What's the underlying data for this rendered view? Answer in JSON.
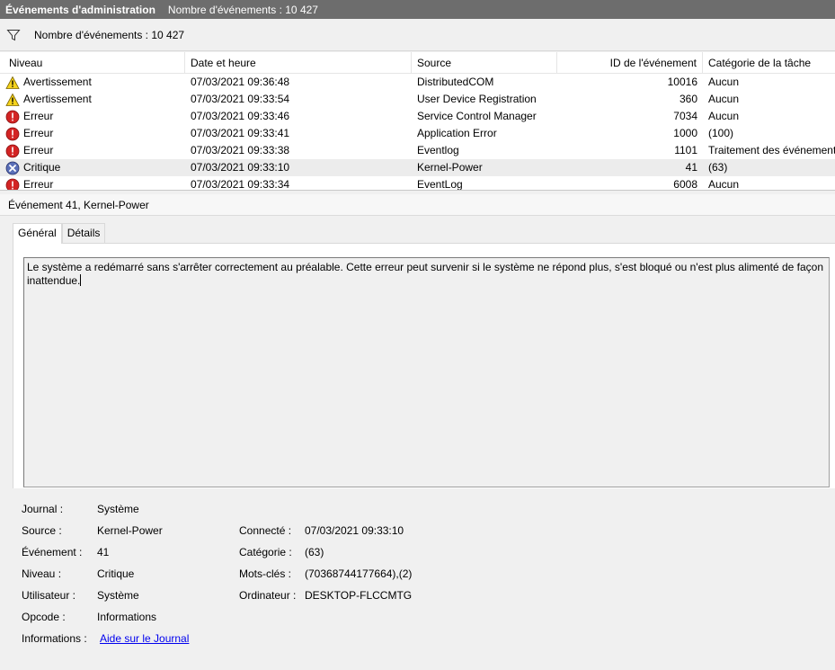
{
  "window": {
    "title": "Événements d'administration",
    "event_count": "Nombre d'événements : 10 427"
  },
  "filterbar": {
    "icon": "filter-icon",
    "count": "Nombre d'événements : 10 427"
  },
  "grid": {
    "headers": [
      "Niveau",
      "Date et heure",
      "Source",
      "ID de l'événement",
      "Catégorie de la tâche"
    ],
    "rows": [
      {
        "level": "Avertissement",
        "level_icon": "warning-icon",
        "date": "07/03/2021 09:36:48",
        "source": "DistributedCOM",
        "id": "10016",
        "category": "Aucun"
      },
      {
        "level": "Avertissement",
        "level_icon": "warning-icon",
        "date": "07/03/2021 09:33:54",
        "source": "User Device Registration",
        "id": "360",
        "category": "Aucun"
      },
      {
        "level": "Erreur",
        "level_icon": "error-icon",
        "date": "07/03/2021 09:33:46",
        "source": "Service Control Manager",
        "id": "7034",
        "category": "Aucun"
      },
      {
        "level": "Erreur",
        "level_icon": "error-icon",
        "date": "07/03/2021 09:33:41",
        "source": "Application Error",
        "id": "1000",
        "category": "(100)"
      },
      {
        "level": "Erreur",
        "level_icon": "error-icon",
        "date": "07/03/2021 09:33:38",
        "source": "Eventlog",
        "id": "1101",
        "category": "Traitement des événements"
      },
      {
        "level": "Critique",
        "level_icon": "critical-icon",
        "date": "07/03/2021 09:33:10",
        "source": "Kernel-Power",
        "id": "41",
        "category": "(63)"
      },
      {
        "level": "Erreur",
        "level_icon": "error-icon",
        "date": "07/03/2021 09:33:34",
        "source": "EventLog",
        "id": "6008",
        "category": "Aucun"
      }
    ]
  },
  "detail": {
    "title": "Événement 41, Kernel-Power",
    "tabs": [
      "Général",
      "Détails"
    ],
    "description": "Le système a redémarré sans s'arrêter correctement au préalable. Cette erreur peut survenir si le système ne répond plus, s'est bloqué ou n'est plus alimenté de façon inattendue.",
    "props": {
      "journal_label": "Journal :",
      "journal": "Système",
      "source_label": "Source :",
      "source": "Kernel-Power",
      "event_label": "Événement :",
      "event": "41",
      "level_label": "Niveau :",
      "level": "Critique",
      "user_label": "Utilisateur :",
      "user": "Système",
      "opcode_label": "Opcode :",
      "opcode": "Informations",
      "info_label": "Informations :",
      "info_link": "Aide sur le Journal",
      "connected_label": "Connecté :",
      "connected": "07/03/2021 09:33:10",
      "category_label": "Catégorie :",
      "category": "(63)",
      "keywords_label": "Mots-clés :",
      "keywords": "(70368744177664),(2)",
      "computer_label": "Ordinateur :",
      "computer": "DESKTOP-FLCCMTG"
    }
  }
}
